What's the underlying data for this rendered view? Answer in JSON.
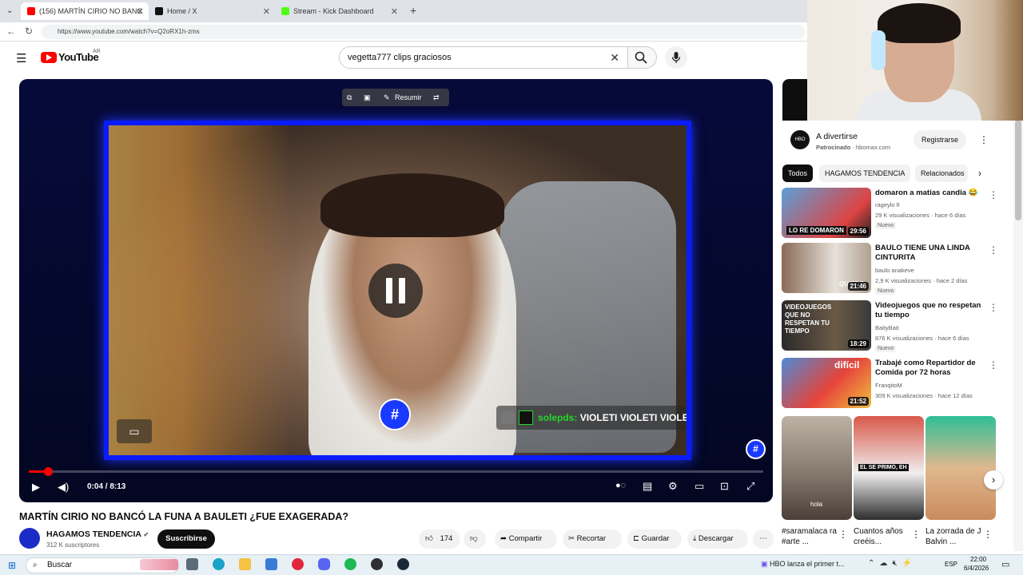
{
  "browser": {
    "tabs": [
      {
        "label": "(156) MARTÍN CIRIO NO BANC",
        "active": true
      },
      {
        "label": "Home / X",
        "active": false
      },
      {
        "label": "Stream - Kick Dashboard",
        "active": false
      }
    ],
    "url": "https://www.youtube.com/watch?v=Q2oRX1h-zms"
  },
  "youtube": {
    "logo_text": "YouTube",
    "region": "AR",
    "search_value": "vegetta777 clips graciosos"
  },
  "player": {
    "toolbar_summary": "Resumir",
    "chat_user": "solepds:",
    "chat_text": "VIOLETI VIOLETI VIOLETI",
    "time": "0:04 / 8:13",
    "progress": 0.008
  },
  "video": {
    "title": "MARTÍN CIRIO NO BANCÓ LA FUNA A BAULETI ¿FUE EXAGERADA?",
    "channel": "HAGAMOS TENDENCIA",
    "subscribers": "312 K suscriptores",
    "subscribe_label": "Suscribirse",
    "likes": "174",
    "share_label": "Compartir",
    "clip_label": "Recortar",
    "save_label": "Guardar",
    "download_label": "Descargar"
  },
  "ad": {
    "logo": "HBO max",
    "title": "A divertirse",
    "sponsored": "Patrocinado",
    "domain": "hbomax.com",
    "cta": "Registrarse"
  },
  "chips": [
    "Todos",
    "HAGAMOS TENDENCIA",
    "Relacionados"
  ],
  "recommendations": [
    {
      "title": "domaron a matias candia 😂",
      "channel": "rageylo fr",
      "meta": "29 K visualizaciones · hace 6 días",
      "badge": "Nuevo",
      "duration": "29:56",
      "thumb_text": "LO RE DOMARON"
    },
    {
      "title": "BAULO TIENE UNA LINDA CINTURITA",
      "channel": "baulo anakeve",
      "meta": "2,9 K visualizaciones · hace 2 días",
      "badge": "Nuevo",
      "duration": "21:46",
      "thumb_text": "QUIERO"
    },
    {
      "title": "Videojuegos que no respetan tu tiempo",
      "channel": "BaityBait",
      "meta": "876 K visualizaciones · hace 6 días",
      "badge": "Nuevo",
      "duration": "18:29",
      "thumb_text": "VIDEOJUEGOS QUE NO RESPETAN TU TIEMPO"
    },
    {
      "title": "Trabajé como Repartidor de Comida por 72 horas",
      "channel": "FranqitoM",
      "meta": "309 K visualizaciones · hace 12 días",
      "badge": "",
      "duration": "21:52",
      "thumb_text": "difícil"
    }
  ],
  "shorts": [
    {
      "title": "#saramalaca ra #arte ...",
      "overlay": "hola"
    },
    {
      "title": "Cuantos años creéis...",
      "overlay": "EL SE PRIMO, EH"
    },
    {
      "title": "La zorrada de J Balvin ...",
      "overlay": ""
    }
  ],
  "taskbar": {
    "search_label": "Buscar",
    "news": "HBO lanza el primer t...",
    "lang": "ESP",
    "time": "22:00",
    "date": "6/4/2026"
  }
}
